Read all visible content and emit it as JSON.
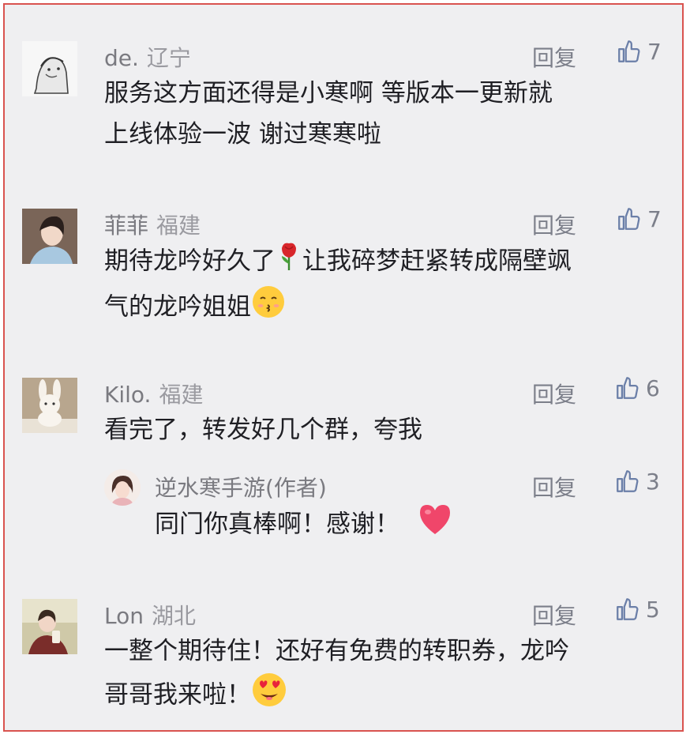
{
  "comments": [
    {
      "user": "de.",
      "region": "辽宁",
      "reply_label": "回复",
      "likes": "7",
      "text_lines": [
        "服务这方面还得是小寒啊  等版本一更新就",
        "上线体验一波  谢过寒寒啦"
      ]
    },
    {
      "user": "菲菲",
      "region": "福建",
      "reply_label": "回复",
      "likes": "7",
      "text_line1_a": "期待龙吟好久了",
      "text_line1_b": "让我碎梦赶紧转成隔壁飒",
      "text_line2": "气的龙吟姐姐"
    },
    {
      "user": "Kilo.",
      "region": "福建",
      "reply_label": "回复",
      "likes": "6",
      "text": "看完了，转发好几个群，夸我"
    },
    {
      "user": "逆水寒手游(作者)",
      "reply_label": "回复",
      "likes": "3",
      "text": "同门你真棒啊！感谢！"
    },
    {
      "user": "Lon",
      "region": "湖北",
      "reply_label": "回复",
      "likes": "5",
      "text_line1": "一整个期待住！还好有免费的转职券，龙吟",
      "text_line2": "哥哥我来啦！"
    }
  ],
  "icons": [
    "thumb-up-icon",
    "rose-icon",
    "kissing-face-icon",
    "heart-icon",
    "heart-eyes-face-icon"
  ],
  "colors": {
    "border": "#d9534f",
    "background": "#efeff1",
    "meta": "#7a7a80",
    "text": "#1f1f24"
  }
}
